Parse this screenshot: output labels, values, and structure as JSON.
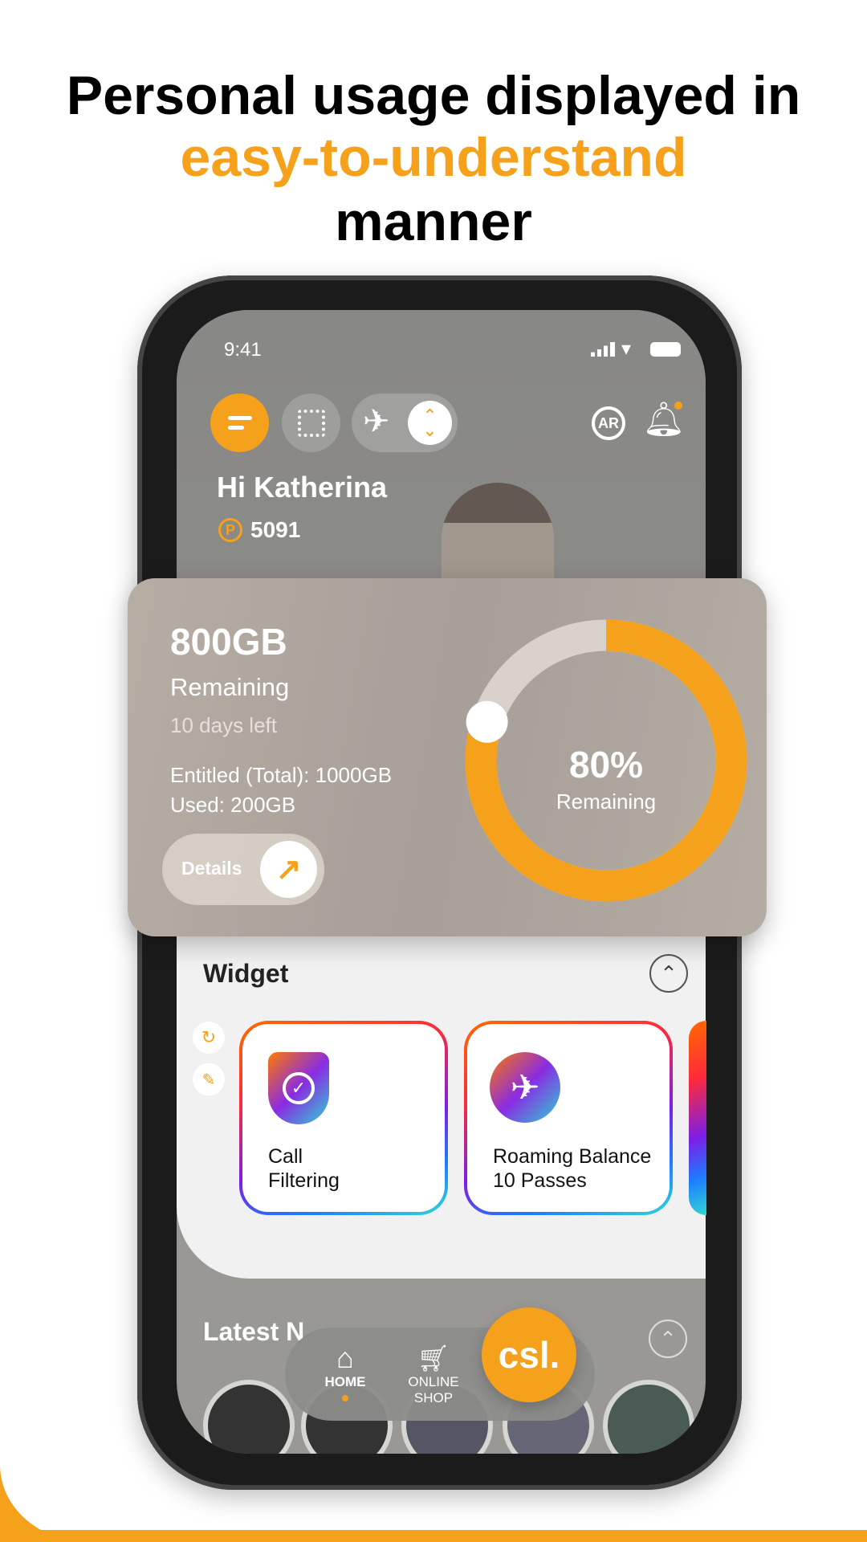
{
  "headline": {
    "line1": "Personal usage displayed in",
    "line2": "easy-to-understand",
    "line3": "manner"
  },
  "colors": {
    "accent": "#F5A11C",
    "text": "#000000"
  },
  "status_bar": {
    "time": "9:41",
    "icons": [
      "signal-icon",
      "wifi-icon",
      "battery-icon"
    ]
  },
  "header": {
    "menu_icon": "menu-icon",
    "qr_icon": "qr-code-icon",
    "roaming_icon": "airplane-icon",
    "switch_icon": "chevron-up-down-icon",
    "ar_label": "AR",
    "bell_icon": "bell-icon"
  },
  "greeting": "Hi Katherina",
  "points": "5091",
  "usage": {
    "remaining": "800GB",
    "remaining_label": "Remaining",
    "days_left": "10 days left",
    "entitled": "Entitled (Total): 1000GB",
    "used": "Used: 200GB",
    "details_label": "Details",
    "percent": "80%",
    "percent_label": "Remaining",
    "percent_value": 80
  },
  "widget": {
    "title": "Widget",
    "cards": [
      {
        "line1": "Call",
        "line2": "Filtering",
        "icon": "shield-check-icon"
      },
      {
        "line1": "Roaming Balance",
        "line2": "10 Passes",
        "icon": "globe-airplane-icon"
      }
    ]
  },
  "latest": {
    "title": "Latest N"
  },
  "nav": {
    "home": "HOME",
    "shop_line1": "ONLINE",
    "shop_line2": "SHOP",
    "logo": "csl."
  }
}
